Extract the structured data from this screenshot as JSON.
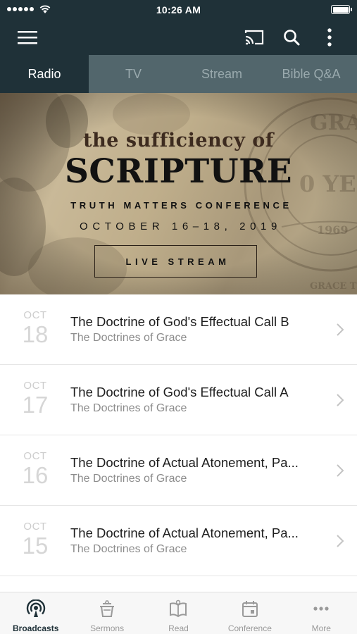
{
  "status_bar": {
    "time": "10:26 AM"
  },
  "nav_bar": {
    "icons": [
      "menu-icon",
      "cast-icon",
      "search-icon",
      "more-vertical-icon"
    ]
  },
  "tabs": [
    {
      "label": "Radio",
      "active": true
    },
    {
      "label": "TV",
      "active": false
    },
    {
      "label": "Stream",
      "active": false
    },
    {
      "label": "Bible Q&A",
      "active": false
    }
  ],
  "hero": {
    "script_title": "the sufficiency of",
    "main_title": "SCRIPTURE",
    "subtitle": "TRUTH MATTERS CONFERENCE",
    "dates": "OCTOBER 16–18, 2019",
    "button_label": "LIVE STREAM"
  },
  "broadcasts": [
    {
      "month": "OCT",
      "day": "18",
      "title": "The Doctrine of God's Effectual Call B",
      "series": "The Doctrines of Grace"
    },
    {
      "month": "OCT",
      "day": "17",
      "title": "The Doctrine of God's Effectual Call A",
      "series": "The Doctrines of Grace"
    },
    {
      "month": "OCT",
      "day": "16",
      "title": "The Doctrine of Actual Atonement, Pa...",
      "series": "The Doctrines of Grace"
    },
    {
      "month": "OCT",
      "day": "15",
      "title": "The Doctrine of Actual Atonement, Pa...",
      "series": "The Doctrines of Grace"
    }
  ],
  "bottom_tabs": [
    {
      "label": "Broadcasts",
      "icon": "broadcast-icon",
      "active": true
    },
    {
      "label": "Sermons",
      "icon": "sermons-icon",
      "active": false
    },
    {
      "label": "Read",
      "icon": "read-icon",
      "active": false
    },
    {
      "label": "Conference",
      "icon": "calendar-icon",
      "active": false
    },
    {
      "label": "More",
      "icon": "more-horizontal-icon",
      "active": false
    }
  ],
  "colors": {
    "header": "#1f3138",
    "tab_inactive_bg": "#52666c",
    "active_accent": "#1f3138"
  }
}
